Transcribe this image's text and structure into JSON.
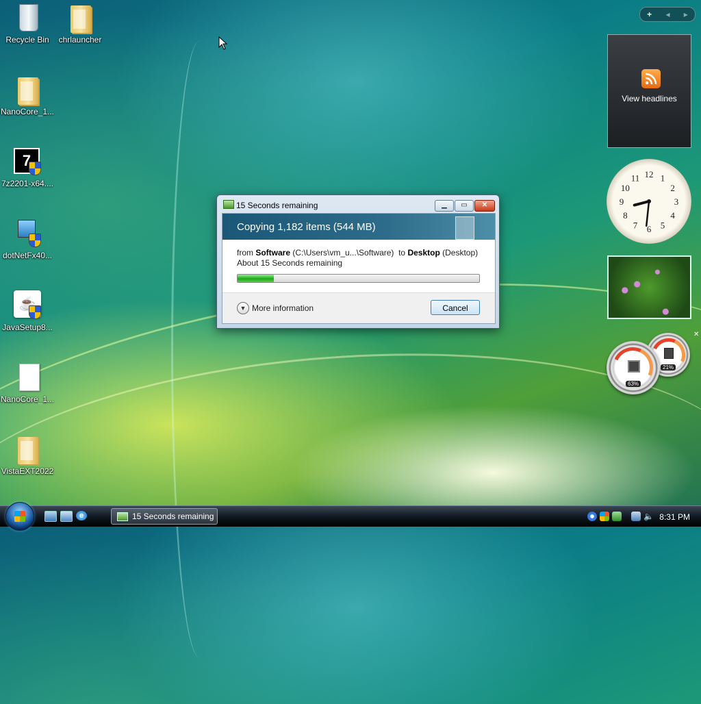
{
  "desktop": {
    "icons": [
      {
        "label": "Recycle Bin",
        "icon": "recycle-bin-icon"
      },
      {
        "label": "chrlauncher",
        "icon": "folder-icon"
      },
      {
        "label": "NanoCore_1...",
        "icon": "folder-icon"
      },
      {
        "label": "7z2201-x64....",
        "icon": "7zip-installer-icon"
      },
      {
        "label": "dotNetFx40...",
        "icon": "installer-icon"
      },
      {
        "label": "JavaSetup8...",
        "icon": "java-installer-icon"
      },
      {
        "label": "NanoCore_1...",
        "icon": "document-icon"
      },
      {
        "label": "VistaEXT2022",
        "icon": "folder-icon"
      }
    ]
  },
  "sidebar": {
    "controls": {
      "add": "+",
      "prev": "◂",
      "next": "▸"
    },
    "feed_gadget": {
      "label": "View headlines"
    },
    "clock": {
      "numerals": [
        "12",
        "1",
        "2",
        "3",
        "4",
        "5",
        "6",
        "7",
        "8",
        "9",
        "10",
        "11"
      ],
      "hour": 8,
      "minute": 31
    },
    "cpu_meter": {
      "cpu": "63%",
      "memory": "21%"
    }
  },
  "copy_dialog": {
    "title": "15 Seconds remaining",
    "header": "Copying 1,182 items (544 MB)",
    "from_word": "from",
    "source_name": "Software",
    "source_path": "(C:\\Users\\vm_u...\\Software)",
    "to_word": "to",
    "dest_name": "Desktop",
    "dest_path": "(Desktop)",
    "remaining": "About 15 Seconds remaining",
    "progress": 0.15,
    "more_info": "More information",
    "cancel": "Cancel",
    "window_buttons": {
      "minimize": "▁",
      "maximize": "▭",
      "close": "✕"
    }
  },
  "taskbar": {
    "task_button": "15 Seconds remaining",
    "time": "8:31 PM"
  },
  "colors": {
    "progress_green": "#1ea818",
    "dialog_header": "#1b5776",
    "close_red": "#c8391b"
  }
}
